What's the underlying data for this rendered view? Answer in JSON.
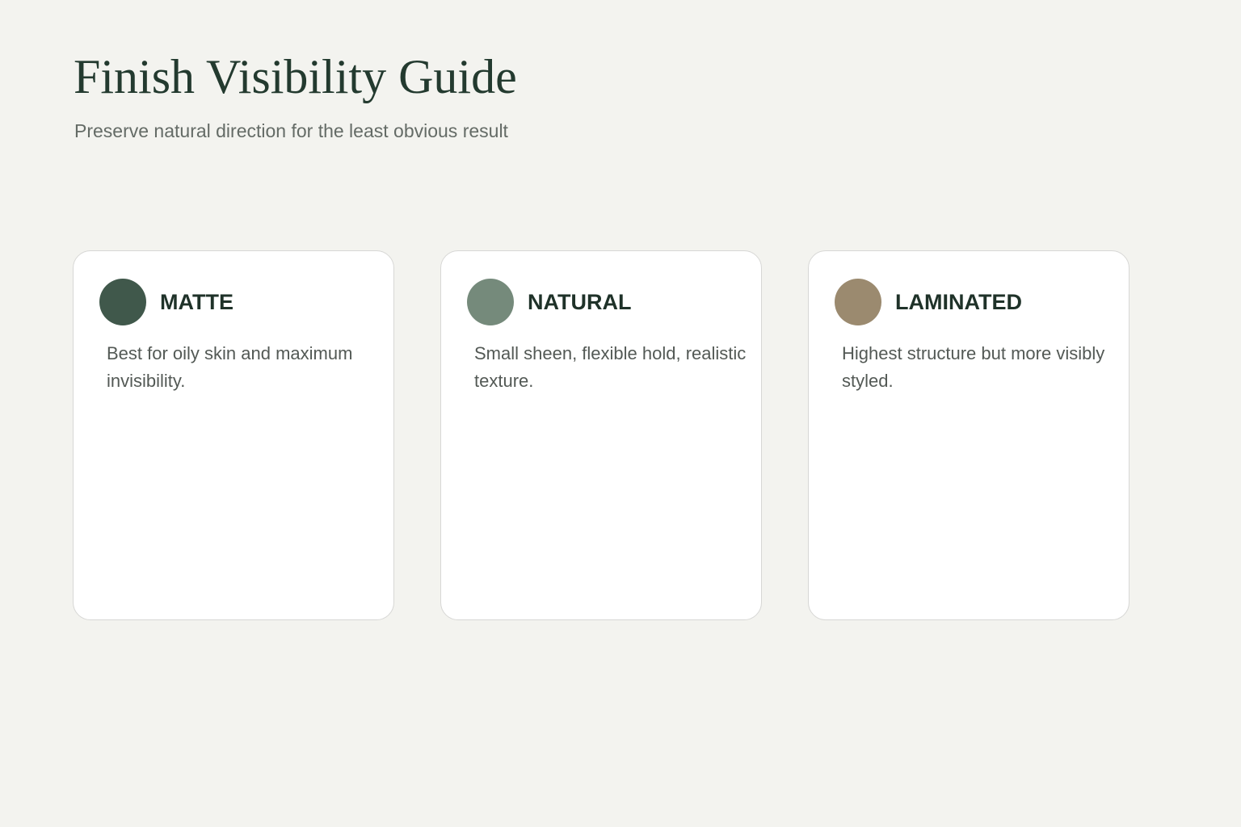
{
  "header": {
    "title": "Finish Visibility Guide",
    "subtitle": "Preserve natural direction for the least obvious result"
  },
  "colors": {
    "background": "#f3f3ef",
    "title": "#233a2f"
  },
  "cards": [
    {
      "title": "MATTE",
      "description": "Best for oily skin and maximum invisibility.",
      "swatch_color": "#40584b"
    },
    {
      "title": "NATURAL",
      "description": "Small sheen, flexible hold, realistic texture.",
      "swatch_color": "#758a7b"
    },
    {
      "title": "LAMINATED",
      "description": "Highest structure but more visibly styled.",
      "swatch_color": "#9b8a6f"
    }
  ]
}
